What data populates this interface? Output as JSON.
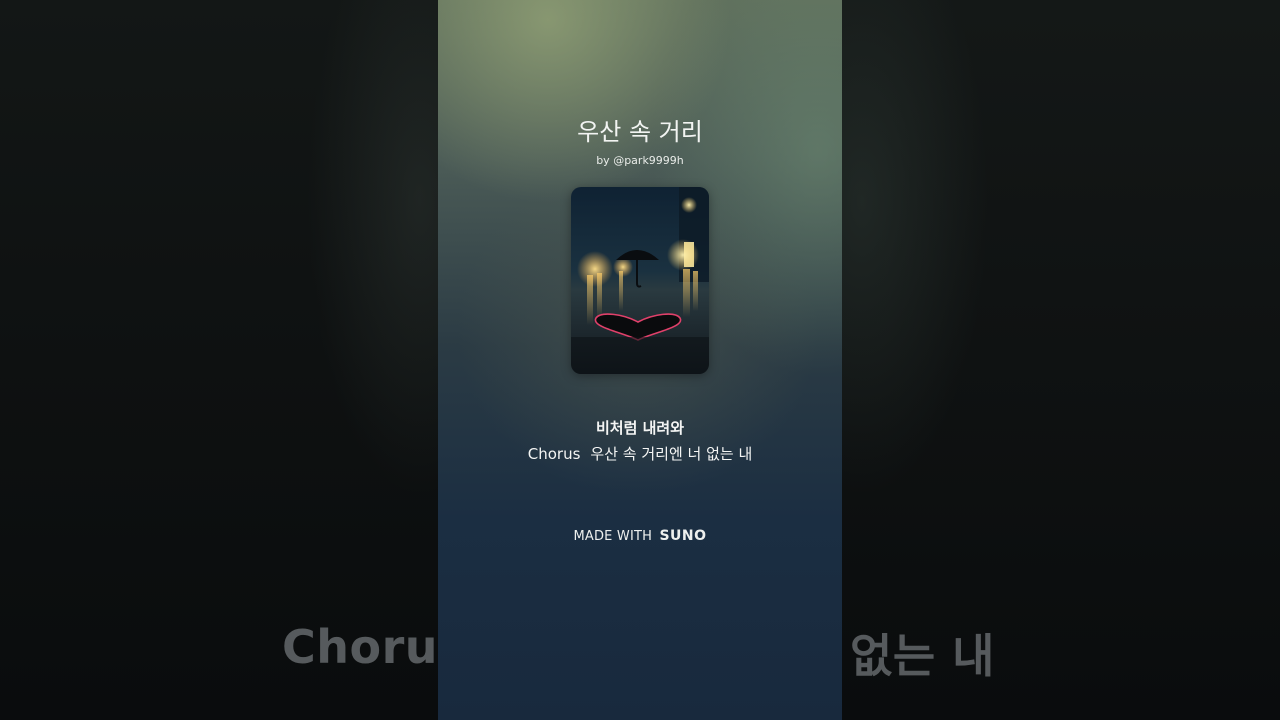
{
  "song": {
    "title": "우산 속 거리",
    "author": "by @park9999h",
    "cover_icon": "umbrella-heart-street-artwork"
  },
  "lyrics": {
    "line1": "비처럼 내려와",
    "section": "Chorus",
    "line2": "우산 속 거리엔 너 없는 내"
  },
  "background": {
    "left_text": "Chorus",
    "right_text": "없는 내"
  },
  "footer": {
    "made_with": "MADE WITH",
    "brand": "SUNO"
  },
  "colors": {
    "panel_top": "#5f6f5c",
    "panel_bottom": "#18293d",
    "text": "#f2f4f2",
    "heart_outline": "#e0406a"
  }
}
